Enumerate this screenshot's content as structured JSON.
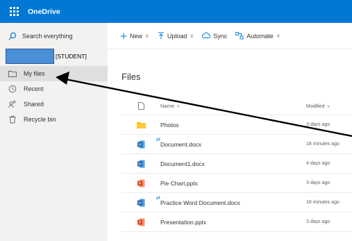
{
  "app": {
    "title": "OneDrive"
  },
  "sidebar": {
    "search_label": "Search everything",
    "account_tag": "[STUDENT]",
    "items": [
      {
        "label": "My files",
        "icon": "folder-icon",
        "active": true
      },
      {
        "label": "Recent",
        "icon": "clock-icon",
        "active": false
      },
      {
        "label": "Shared",
        "icon": "people-icon",
        "active": false
      },
      {
        "label": "Recycle bin",
        "icon": "trash-icon",
        "active": false
      }
    ]
  },
  "commands": [
    {
      "label": "New",
      "icon": "plus-icon"
    },
    {
      "label": "Upload",
      "icon": "upload-icon"
    },
    {
      "label": "Sync",
      "icon": "sync-icon"
    },
    {
      "label": "Automate",
      "icon": "automate-icon"
    }
  ],
  "main": {
    "title": "Files",
    "columns": {
      "name": "Name",
      "modified": "Modified"
    },
    "files": [
      {
        "name": "Photos",
        "type": "folder",
        "modified": "3 days ago",
        "synced": false
      },
      {
        "name": "Document.docx",
        "type": "word",
        "modified": "18 minutes ago",
        "synced": true
      },
      {
        "name": "Document1.docx",
        "type": "word",
        "modified": "4 days ago",
        "synced": false
      },
      {
        "name": "Pie Chart.pptx",
        "type": "powerpoint",
        "modified": "3 days ago",
        "synced": false
      },
      {
        "name": "Practice Word Document.docx",
        "type": "word",
        "modified": "18 minutes ago",
        "synced": true
      },
      {
        "name": "Presentation.pptx",
        "type": "powerpoint",
        "modified": "3 days ago",
        "synced": false
      }
    ]
  },
  "colors": {
    "brand": "#0078d4",
    "sidebar_bg": "#f3f2f1",
    "active_item": "#e1dfdd",
    "folder": "#ffb900",
    "word": "#2b579a",
    "powerpoint": "#d24726"
  }
}
